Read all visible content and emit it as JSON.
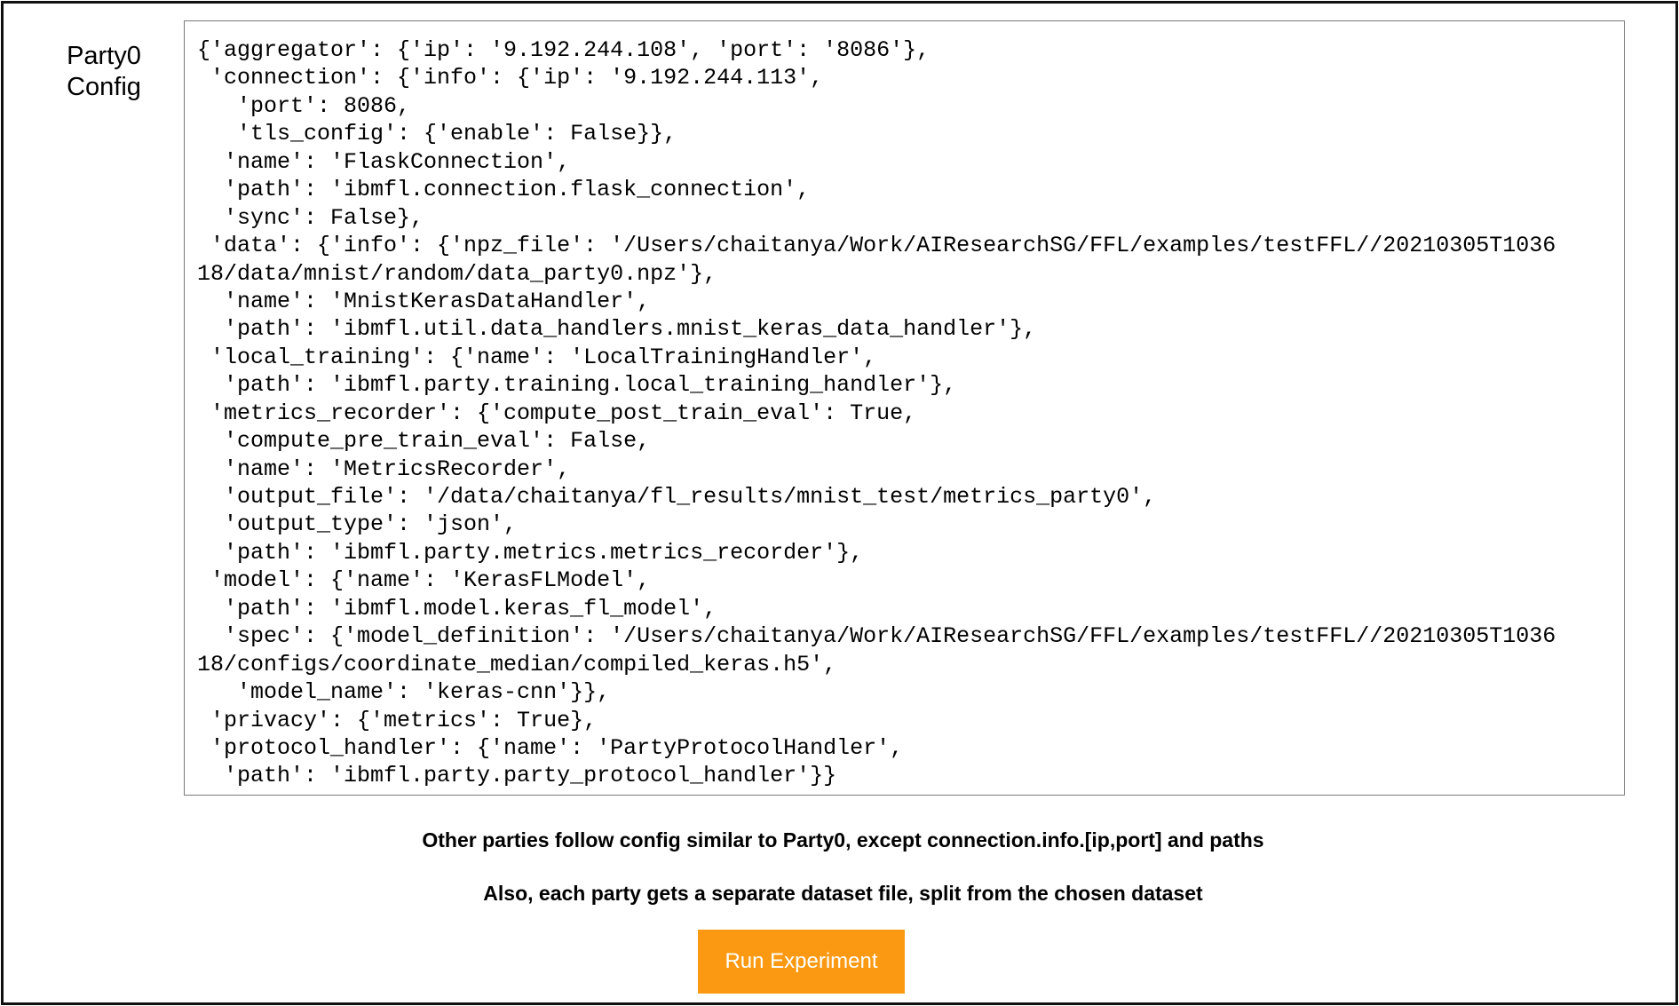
{
  "label": {
    "line1": "Party0",
    "line2": "Config"
  },
  "config_lines": [
    "{'aggregator': {'ip': '9.192.244.108', 'port': '8086'},",
    " 'connection': {'info': {'ip': '9.192.244.113',",
    "   'port': 8086,",
    "   'tls_config': {'enable': False}},",
    "  'name': 'FlaskConnection',",
    "  'path': 'ibmfl.connection.flask_connection',",
    "  'sync': False},",
    " 'data': {'info': {'npz_file': '/Users/chaitanya/Work/AIResearchSG/FFL/examples/testFFL//20210305T1036",
    "18/data/mnist/random/data_party0.npz'},",
    "  'name': 'MnistKerasDataHandler',",
    "  'path': 'ibmfl.util.data_handlers.mnist_keras_data_handler'},",
    " 'local_training': {'name': 'LocalTrainingHandler',",
    "  'path': 'ibmfl.party.training.local_training_handler'},",
    " 'metrics_recorder': {'compute_post_train_eval': True,",
    "  'compute_pre_train_eval': False,",
    "  'name': 'MetricsRecorder',",
    "  'output_file': '/data/chaitanya/fl_results/mnist_test/metrics_party0',",
    "  'output_type': 'json',",
    "  'path': 'ibmfl.party.metrics.metrics_recorder'},",
    " 'model': {'name': 'KerasFLModel',",
    "  'path': 'ibmfl.model.keras_fl_model',",
    "  'spec': {'model_definition': '/Users/chaitanya/Work/AIResearchSG/FFL/examples/testFFL//20210305T1036",
    "18/configs/coordinate_median/compiled_keras.h5',",
    "   'model_name': 'keras-cnn'}},",
    " 'privacy': {'metrics': True},",
    " 'protocol_handler': {'name': 'PartyProtocolHandler',",
    "  'path': 'ibmfl.party.party_protocol_handler'}}"
  ],
  "notes": {
    "other_parties": "Other parties follow config similar to Party0, except connection.info.[ip,port] and paths",
    "dataset_split": "Also, each party gets a separate dataset file, split from the chosen dataset"
  },
  "run_button": {
    "label": "Run Experiment"
  },
  "colors": {
    "button_bg": "#fb9a12",
    "button_text": "#ffffff",
    "frame_border": "#111111",
    "code_border": "#7a7a7a"
  }
}
